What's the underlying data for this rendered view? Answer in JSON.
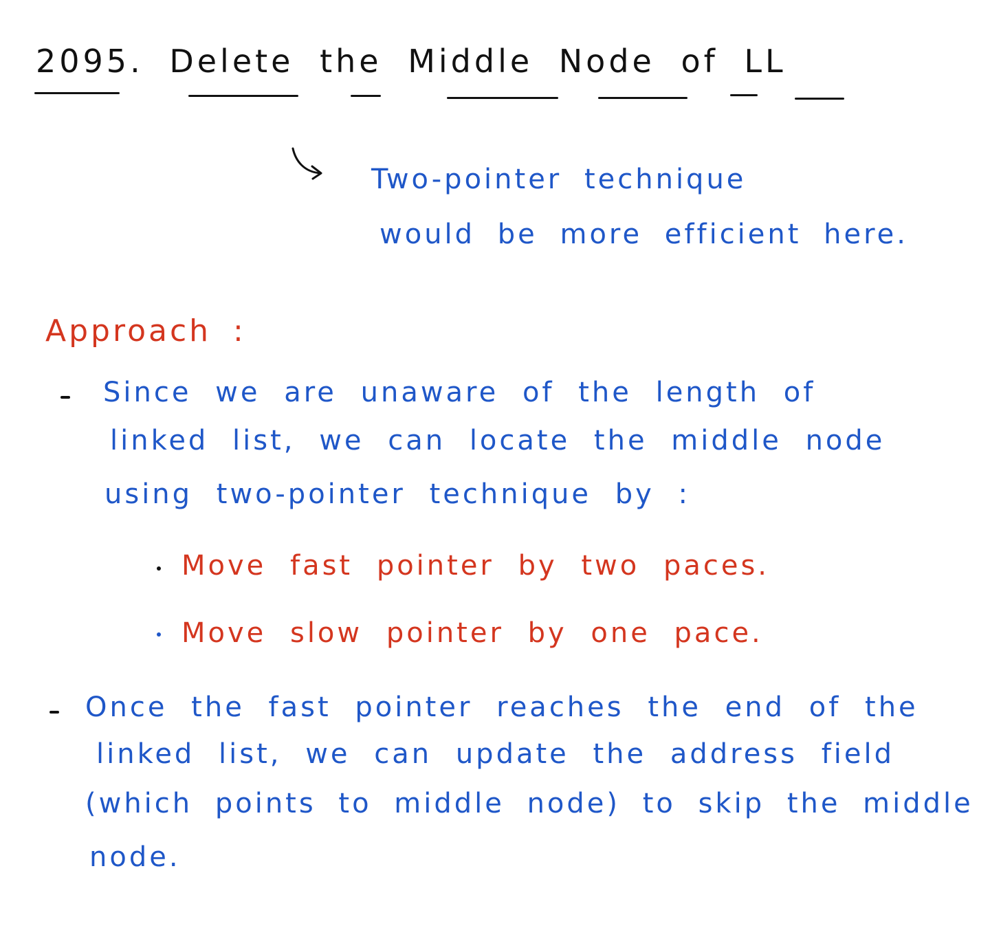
{
  "title": {
    "number": "2095.",
    "text": "Delete the Middle Node of LL"
  },
  "note": {
    "line1": "Two-pointer technique",
    "line2": "would be more efficient here."
  },
  "approach": {
    "heading": "Approach :",
    "point1": [
      "Since we are unaware of the length of",
      "linked list, we can locate the middle node",
      "using two-pointer technique by :"
    ],
    "sub_bullets": [
      "Move fast pointer by two paces.",
      "Move slow pointer by one pace."
    ],
    "point2": [
      "Once the fast pointer reaches the end of the",
      "linked list, we can update the address field",
      "(which points to middle node) to skip the middle",
      "node."
    ]
  },
  "colors": {
    "ink_black": "#111111",
    "ink_blue": "#1f57c8",
    "ink_red": "#d4361f"
  }
}
